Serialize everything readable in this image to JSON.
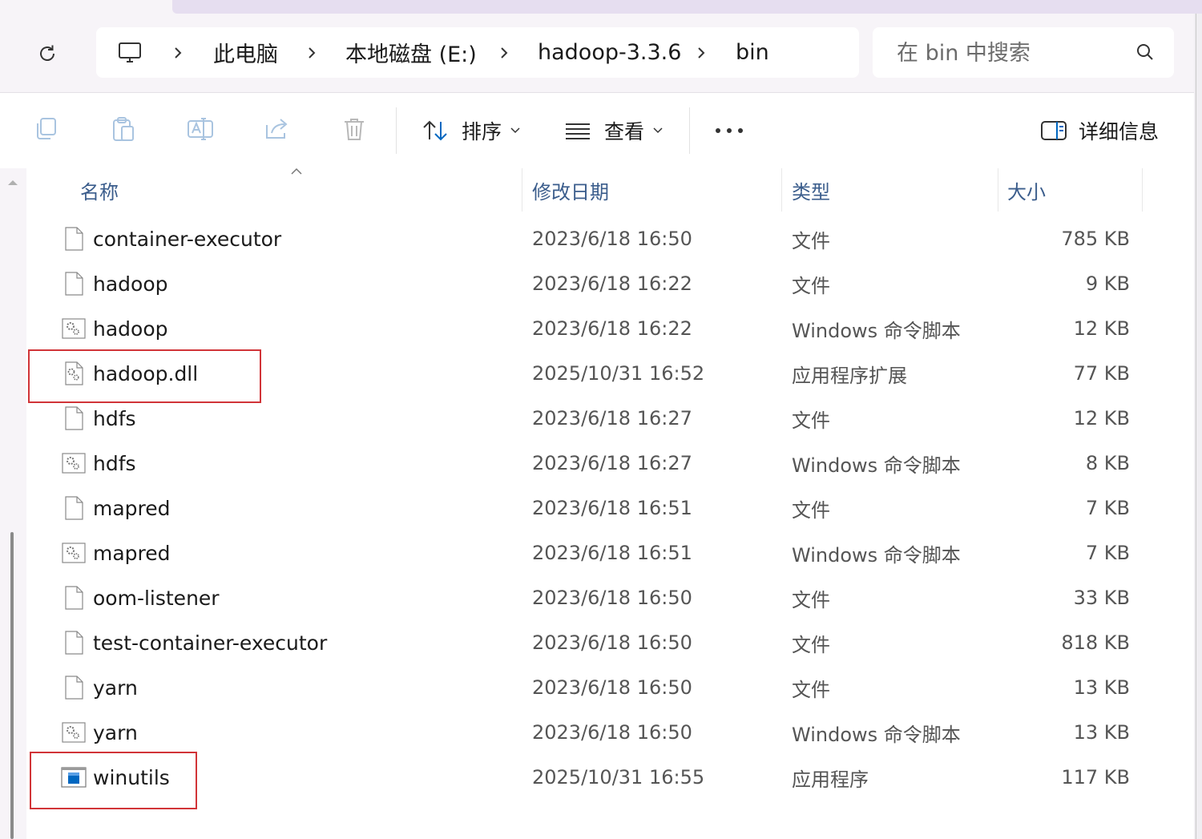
{
  "address_bar": {
    "refresh_icon": "refresh-icon",
    "computer_icon": "computer-icon",
    "breadcrumb": [
      "此电脑",
      "本地磁盘 (E:)",
      "hadoop-3.3.6",
      "bin"
    ],
    "search_placeholder": "在 bin 中搜索",
    "search_icon": "search-icon"
  },
  "toolbar": {
    "copy_icon": "copy-icon",
    "paste_icon": "paste-icon",
    "rename_icon": "rename-icon",
    "share_icon": "share-icon",
    "delete_icon": "delete-icon",
    "sort_label": "排序",
    "view_label": "查看",
    "more_icon": "more-icon",
    "details_label": "详细信息"
  },
  "columns": {
    "name": "名称",
    "date": "修改日期",
    "type": "类型",
    "size": "大小"
  },
  "files": [
    {
      "name": "container-executor",
      "date": "2023/6/18 16:50",
      "type": "文件",
      "size": "785 KB",
      "icon": "file-icon"
    },
    {
      "name": "hadoop",
      "date": "2023/6/18 16:22",
      "type": "文件",
      "size": "9 KB",
      "icon": "file-icon"
    },
    {
      "name": "hadoop",
      "date": "2023/6/18 16:22",
      "type": "Windows 命令脚本",
      "size": "12 KB",
      "icon": "script-icon"
    },
    {
      "name": "hadoop.dll",
      "date": "2025/10/31 16:52",
      "type": "应用程序扩展",
      "size": "77 KB",
      "icon": "dll-icon"
    },
    {
      "name": "hdfs",
      "date": "2023/6/18 16:27",
      "type": "文件",
      "size": "12 KB",
      "icon": "file-icon"
    },
    {
      "name": "hdfs",
      "date": "2023/6/18 16:27",
      "type": "Windows 命令脚本",
      "size": "8 KB",
      "icon": "script-icon"
    },
    {
      "name": "mapred",
      "date": "2023/6/18 16:51",
      "type": "文件",
      "size": "7 KB",
      "icon": "file-icon"
    },
    {
      "name": "mapred",
      "date": "2023/6/18 16:51",
      "type": "Windows 命令脚本",
      "size": "7 KB",
      "icon": "script-icon"
    },
    {
      "name": "oom-listener",
      "date": "2023/6/18 16:50",
      "type": "文件",
      "size": "33 KB",
      "icon": "file-icon"
    },
    {
      "name": "test-container-executor",
      "date": "2023/6/18 16:50",
      "type": "文件",
      "size": "818 KB",
      "icon": "file-icon"
    },
    {
      "name": "yarn",
      "date": "2023/6/18 16:50",
      "type": "文件",
      "size": "13 KB",
      "icon": "file-icon"
    },
    {
      "name": "yarn",
      "date": "2023/6/18 16:50",
      "type": "Windows 命令脚本",
      "size": "13 KB",
      "icon": "script-icon"
    },
    {
      "name": "winutils",
      "date": "2025/10/31 16:55",
      "type": "应用程序",
      "size": "117 KB",
      "icon": "exe-icon"
    }
  ],
  "colors": {
    "highlight": "#d13438",
    "header_text": "#3b5d8c",
    "accent": "#0067c0"
  }
}
